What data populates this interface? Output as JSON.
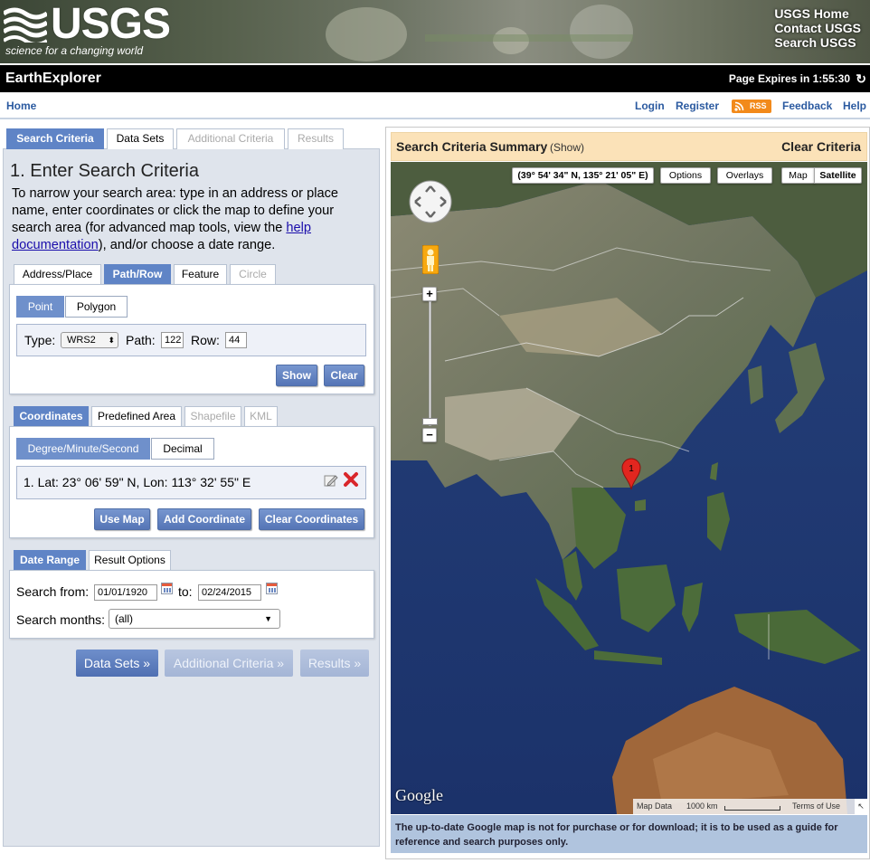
{
  "header": {
    "logo_text": "USGS",
    "tagline": "science for a changing world",
    "links": [
      "USGS Home",
      "Contact USGS",
      "Search USGS"
    ]
  },
  "titlebar": {
    "app_name": "EarthExplorer",
    "page_expires": "Page Expires in 1:55:30"
  },
  "nav": {
    "home": "Home",
    "login": "Login",
    "register": "Register",
    "rss": "RSS",
    "feedback": "Feedback",
    "help": "Help"
  },
  "main_tabs": {
    "search_criteria": "Search Criteria",
    "data_sets": "Data Sets",
    "additional_criteria": "Additional Criteria",
    "results": "Results"
  },
  "step": {
    "title": "1. Enter Search Criteria",
    "instructions_before_link": "To narrow your search area: type in an address or place name, enter coordinates or click the map to define your search area (for advanced map tools, view the ",
    "help_link": "help documentation",
    "instructions_after_link": "), and/or choose a date range."
  },
  "area_tabs": {
    "address_place": "Address/Place",
    "path_row": "Path/Row",
    "feature": "Feature",
    "circle": "Circle"
  },
  "path_row": {
    "point": "Point",
    "polygon": "Polygon",
    "type_label": "Type:",
    "type_value": "WRS2",
    "path_label": "Path:",
    "path_value": "122",
    "row_label": "Row:",
    "row_value": "44",
    "show_button": "Show",
    "clear_button": "Clear"
  },
  "coord_tabs": {
    "coordinates": "Coordinates",
    "predefined_area": "Predefined Area",
    "shapefile": "Shapefile",
    "kml": "KML"
  },
  "coordinates": {
    "dms": "Degree/Minute/Second",
    "decimal": "Decimal",
    "entries": [
      "1.  Lat: 23° 06' 59\" N, Lon: 113° 32' 55\" E"
    ],
    "use_map": "Use Map",
    "add_coordinate": "Add Coordinate",
    "clear_coordinates": "Clear Coordinates"
  },
  "date_tabs": {
    "date_range": "Date Range",
    "result_options": "Result Options"
  },
  "date_range": {
    "search_from_label": "Search from:",
    "from_value": "01/01/1920",
    "to_label": "to:",
    "to_value": "02/24/2015",
    "months_label": "Search months:",
    "months_value": "(all)"
  },
  "step_buttons": {
    "data_sets": "Data Sets »",
    "additional_criteria": "Additional Criteria »",
    "results": "Results »"
  },
  "summary": {
    "title": "Search Criteria Summary",
    "show": "(Show)",
    "clear": "Clear Criteria"
  },
  "map": {
    "coordinate_readout": "(39° 54' 34\" N, 135° 21' 05\" E)",
    "options": "Options",
    "overlays": "Overlays",
    "map_type": "Map",
    "satellite": "Satellite",
    "marker_label": "1",
    "google": "Google",
    "map_data": "Map Data",
    "scale": "1000 km",
    "terms": "Terms of Use",
    "zoom_in": "+",
    "zoom_out": "−"
  },
  "disclaimer": "The up-to-date Google map is not for purchase or for download; it is to be used as a guide for reference and search purposes only.",
  "colors": {
    "accent_blue": "#5f84c6",
    "summary_bar": "#fbe2b8",
    "disclaimer_bg": "#b0c4de",
    "rss_orange": "#f28a1b",
    "delete_red": "#d9262a"
  }
}
